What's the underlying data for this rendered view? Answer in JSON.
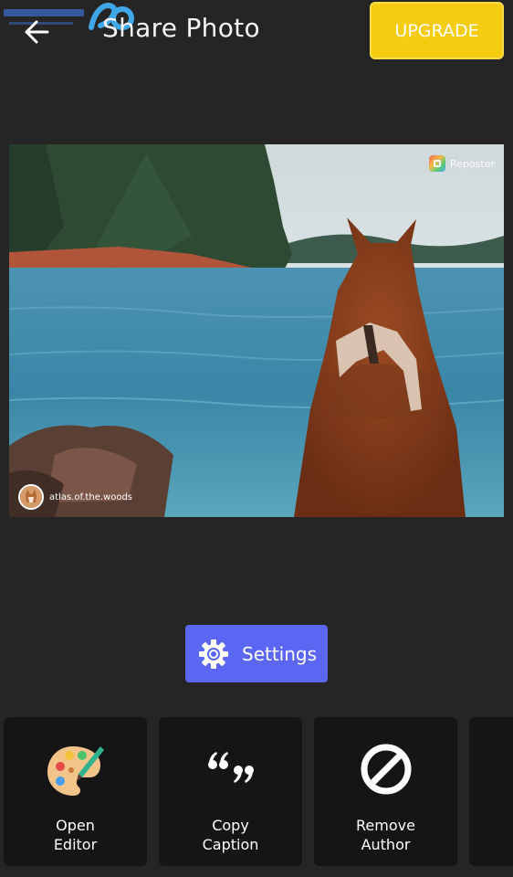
{
  "header": {
    "back_icon": "arrow-left-icon",
    "title": "Share Photo",
    "upgrade_label": "UPGRADE"
  },
  "photo": {
    "description_icon": "photo-preview",
    "reposter_label": "Reposter",
    "author_handle": "atlas.of.the.woods"
  },
  "settings": {
    "icon": "gear-icon",
    "label": "Settings"
  },
  "actions": [
    {
      "icon": "palette-icon",
      "line1": "Open",
      "line2": "Editor"
    },
    {
      "icon": "quote-icon",
      "line1": "Copy",
      "line2": "Caption"
    },
    {
      "icon": "prohibited-icon",
      "line1": "Remove",
      "line2": "Author"
    }
  ],
  "colors": {
    "background": "#252525",
    "upgrade": "#f6cc11",
    "settings": "#5b67f2",
    "card": "#151515"
  }
}
